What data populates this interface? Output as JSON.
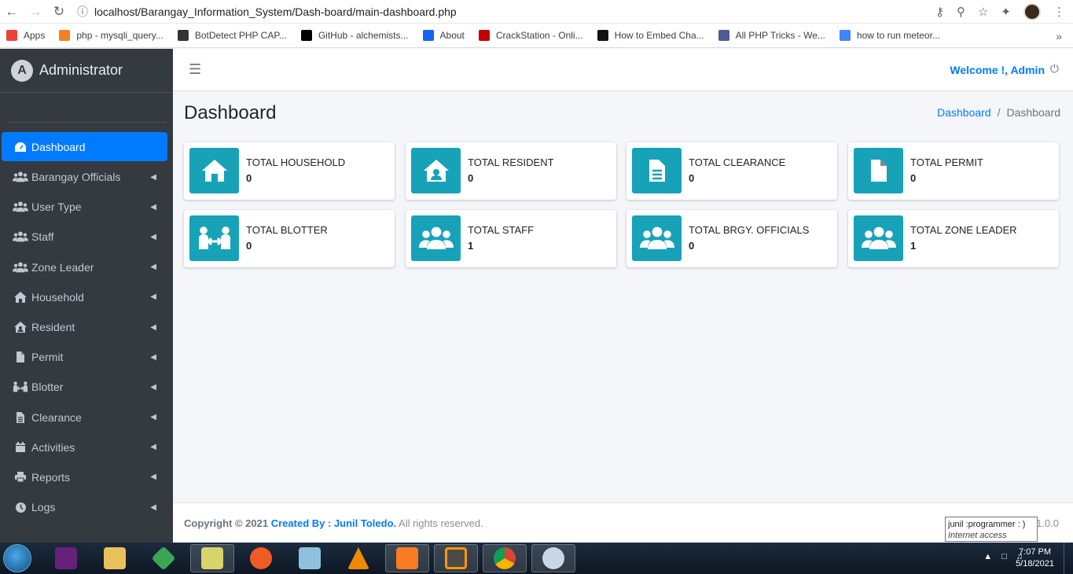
{
  "browser": {
    "url": "localhost/Barangay_Information_System/Dash-board/main-dashboard.php",
    "bookmarks": [
      {
        "label": "Apps",
        "icon": "apps-grid-icon",
        "color": "#ea4335"
      },
      {
        "label": "php - mysqli_query...",
        "icon": "stack-icon",
        "color": "#f48024"
      },
      {
        "label": "BotDetect PHP CAP...",
        "icon": "botdetect-icon",
        "color": "#333333"
      },
      {
        "label": "GitHub - alchemists...",
        "icon": "github-icon",
        "color": "#000000"
      },
      {
        "label": "About",
        "icon": "mdb-icon",
        "color": "#1266f1"
      },
      {
        "label": "CrackStation - Onli...",
        "icon": "crackstation-icon",
        "color": "#c00000"
      },
      {
        "label": "How to Embed Cha...",
        "icon": "ch-icon",
        "color": "#111111"
      },
      {
        "label": "All PHP Tricks - We...",
        "icon": "php-icon",
        "color": "#4f5b93"
      },
      {
        "label": "how to run meteor...",
        "icon": "google-icon",
        "color": "#4285f4"
      }
    ]
  },
  "sidebar": {
    "brand": "Administrator",
    "brand_logo": "A",
    "items": [
      {
        "label": "Dashboard",
        "icon": "dashboard-icon",
        "active": true
      },
      {
        "label": "Barangay Officials",
        "icon": "users-icon"
      },
      {
        "label": "User Type",
        "icon": "users-icon"
      },
      {
        "label": "Staff",
        "icon": "users-icon"
      },
      {
        "label": "Zone Leader",
        "icon": "users-icon"
      },
      {
        "label": "Household",
        "icon": "home-icon"
      },
      {
        "label": "Resident",
        "icon": "house-user-icon"
      },
      {
        "label": "Permit",
        "icon": "file-icon"
      },
      {
        "label": "Blotter",
        "icon": "people-arrows-icon"
      },
      {
        "label": "Clearance",
        "icon": "file-alt-icon"
      },
      {
        "label": "Activities",
        "icon": "calendar-icon"
      },
      {
        "label": "Reports",
        "icon": "print-icon"
      },
      {
        "label": "Logs",
        "icon": "clock-icon"
      }
    ]
  },
  "header": {
    "welcome": "Welcome !, Admin"
  },
  "page": {
    "title": "Dashboard",
    "breadcrumb": [
      "Dashboard",
      "Dashboard"
    ]
  },
  "stats": [
    {
      "label": "TOTAL HOUSEHOLD",
      "value": "0",
      "icon": "home-icon"
    },
    {
      "label": "TOTAL RESIDENT",
      "value": "0",
      "icon": "house-user-icon"
    },
    {
      "label": "TOTAL CLEARANCE",
      "value": "0",
      "icon": "file-alt-icon"
    },
    {
      "label": "TOTAL PERMIT",
      "value": "0",
      "icon": "file-icon"
    },
    {
      "label": "TOTAL BLOTTER",
      "value": "0",
      "icon": "people-arrows-icon"
    },
    {
      "label": "TOTAL STAFF",
      "value": "1",
      "icon": "users-icon"
    },
    {
      "label": "TOTAL BRGY. OFFICIALS",
      "value": "0",
      "icon": "users-icon"
    },
    {
      "label": "TOTAL ZONE LEADER",
      "value": "1",
      "icon": "users-icon"
    }
  ],
  "footer": {
    "copyright": "Copyright © 2021",
    "created_by": "Created By : Junil Toledo.",
    "rights": "All rights reserved.",
    "version": "1.0.0"
  },
  "tooltip": {
    "line1": "junil :programmer : )",
    "line2": "Internet access"
  },
  "taskbar": {
    "time": "7:07 PM",
    "date": "5/18/2021"
  },
  "colors": {
    "accent": "#007bff",
    "info": "#17a2b8",
    "sidebar": "#343a40"
  }
}
